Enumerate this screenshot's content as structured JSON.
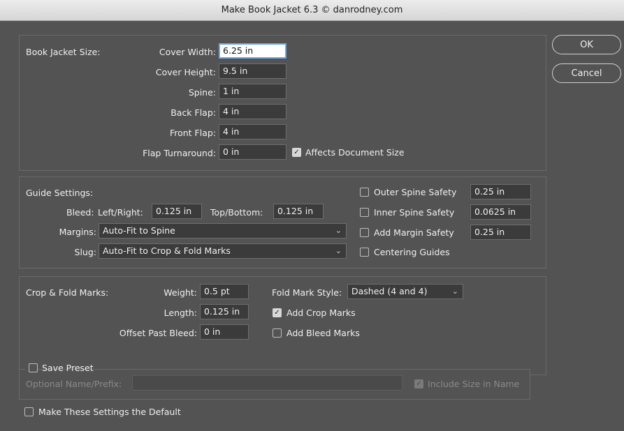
{
  "window": {
    "title": "Make Book Jacket 6.3 © danrodney.com"
  },
  "buttons": {
    "ok": "OK",
    "cancel": "Cancel"
  },
  "jacket": {
    "section_label": "Book Jacket Size:",
    "cover_width": {
      "label": "Cover Width:",
      "value": "6.25 in"
    },
    "cover_height": {
      "label": "Cover Height:",
      "value": "9.5 in"
    },
    "spine": {
      "label": "Spine:",
      "value": "1 in"
    },
    "back_flap": {
      "label": "Back Flap:",
      "value": "4 in"
    },
    "front_flap": {
      "label": "Front Flap:",
      "value": "4 in"
    },
    "flap_turnaround": {
      "label": "Flap Turnaround:",
      "value": "0 in"
    },
    "affects_doc_size": {
      "label": "Affects Document Size",
      "checked": true
    }
  },
  "guides": {
    "section_label": "Guide Settings:",
    "bleed_label": "Bleed:",
    "left_right": {
      "label": "Left/Right:",
      "value": "0.125 in"
    },
    "top_bottom": {
      "label": "Top/Bottom:",
      "value": "0.125 in"
    },
    "margins": {
      "label": "Margins:",
      "value": "Auto-Fit to Spine"
    },
    "slug": {
      "label": "Slug:",
      "value": "Auto-Fit to Crop & Fold Marks"
    },
    "outer_spine_safety": {
      "label": "Outer Spine Safety",
      "checked": false,
      "value": "0.25 in"
    },
    "inner_spine_safety": {
      "label": "Inner Spine Safety",
      "checked": false,
      "value": "0.0625 in"
    },
    "add_margin_safety": {
      "label": "Add Margin Safety",
      "checked": false,
      "value": "0.25 in"
    },
    "centering_guides": {
      "label": "Centering Guides",
      "checked": false
    }
  },
  "marks": {
    "section_label": "Crop & Fold Marks:",
    "weight": {
      "label": "Weight:",
      "value": "0.5 pt"
    },
    "length": {
      "label": "Length:",
      "value": "0.125 in"
    },
    "offset": {
      "label": "Offset Past Bleed:",
      "value": "0 in"
    },
    "fold_style": {
      "label": "Fold Mark Style:",
      "value": "Dashed (4 and 4)"
    },
    "add_crop_marks": {
      "label": "Add Crop Marks",
      "checked": true
    },
    "add_bleed_marks": {
      "label": "Add Bleed Marks",
      "checked": false
    }
  },
  "preset": {
    "save_label": "Save Preset",
    "save_checked": false,
    "name_label": "Optional Name/Prefix:",
    "name_value": "",
    "include_size_label": "Include Size in Name",
    "include_size_checked": true
  },
  "default_setting": {
    "label": "Make These Settings the Default",
    "checked": false
  },
  "icons": {
    "checkmark": "✓",
    "chevron": "⌄"
  }
}
